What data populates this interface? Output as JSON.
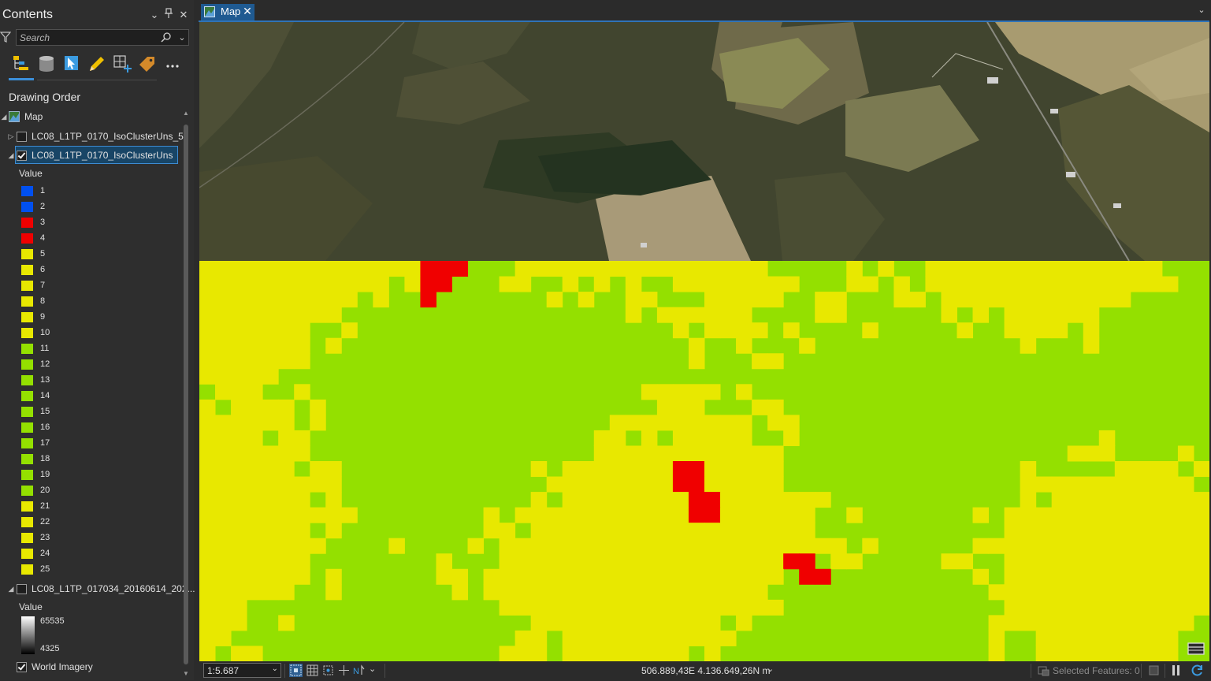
{
  "pane": {
    "title": "Contents",
    "search_placeholder": "Search",
    "drawing_order_label": "Drawing Order",
    "icons": {
      "collapse": "chevron-down-icon",
      "pin": "pin-icon",
      "close": "close-icon",
      "filter": "filter-icon",
      "search": "search-icon",
      "toolbar": [
        "list-by-drawing-order-icon",
        "list-by-source-icon",
        "list-by-selection-icon",
        "list-by-editing-icon",
        "list-by-snapping-icon",
        "list-by-labeling-icon",
        "more-icon"
      ]
    }
  },
  "tree": {
    "map_label": "Map",
    "layers": [
      {
        "label": "LC08_L1TP_0170_IsoClusterUns_5",
        "checked": false,
        "expanded": false
      },
      {
        "label": "LC08_L1TP_0170_IsoClusterUns",
        "checked": true,
        "expanded": true,
        "selected": true
      },
      {
        "label": "LC08_L1TP_017034_20160614_202...",
        "checked": false,
        "expanded": true
      },
      {
        "label": "World Imagery",
        "checked": true,
        "expanded": false
      }
    ],
    "value_heading": "Value",
    "classes": [
      {
        "value": "1",
        "color": "#0050f0"
      },
      {
        "value": "2",
        "color": "#0050f0"
      },
      {
        "value": "3",
        "color": "#f00000"
      },
      {
        "value": "4",
        "color": "#f00000"
      },
      {
        "value": "5",
        "color": "#e8e800"
      },
      {
        "value": "6",
        "color": "#e8e800"
      },
      {
        "value": "7",
        "color": "#e8e800"
      },
      {
        "value": "8",
        "color": "#e8e800"
      },
      {
        "value": "9",
        "color": "#e8e800"
      },
      {
        "value": "10",
        "color": "#e8e800"
      },
      {
        "value": "11",
        "color": "#94e000"
      },
      {
        "value": "12",
        "color": "#94e000"
      },
      {
        "value": "13",
        "color": "#94e000"
      },
      {
        "value": "14",
        "color": "#94e000"
      },
      {
        "value": "15",
        "color": "#94e000"
      },
      {
        "value": "16",
        "color": "#94e000"
      },
      {
        "value": "17",
        "color": "#94e000"
      },
      {
        "value": "18",
        "color": "#94e000"
      },
      {
        "value": "19",
        "color": "#94e000"
      },
      {
        "value": "20",
        "color": "#94e000"
      },
      {
        "value": "21",
        "color": "#e8e800"
      },
      {
        "value": "22",
        "color": "#e8e800"
      },
      {
        "value": "23",
        "color": "#e8e800"
      },
      {
        "value": "24",
        "color": "#e8e800"
      },
      {
        "value": "25",
        "color": "#e8e800"
      }
    ],
    "stretch_value_heading": "Value",
    "stretch_high": "65535",
    "stretch_low": "4325"
  },
  "tab": {
    "label": "Map",
    "icons": {
      "map": "map-icon",
      "close": "close-icon",
      "menu": "chevron-down-icon"
    }
  },
  "map": {
    "raster_colors": {
      "yellow": "#e8e800",
      "green": "#94e000",
      "red": "#f00000"
    },
    "corner_button_icon": "table-icon"
  },
  "status": {
    "scale": "1:5.687",
    "coordinates": "506.889,43E 4.136.649,26N m",
    "selected_features": "Selected Features: 0",
    "icons": [
      "fixed-zoom-icon",
      "grid-icon",
      "snapping-icon",
      "north-arrow-icon",
      "chevron-down-icon",
      "selection-icon",
      "pause-icon",
      "refresh-icon"
    ]
  }
}
